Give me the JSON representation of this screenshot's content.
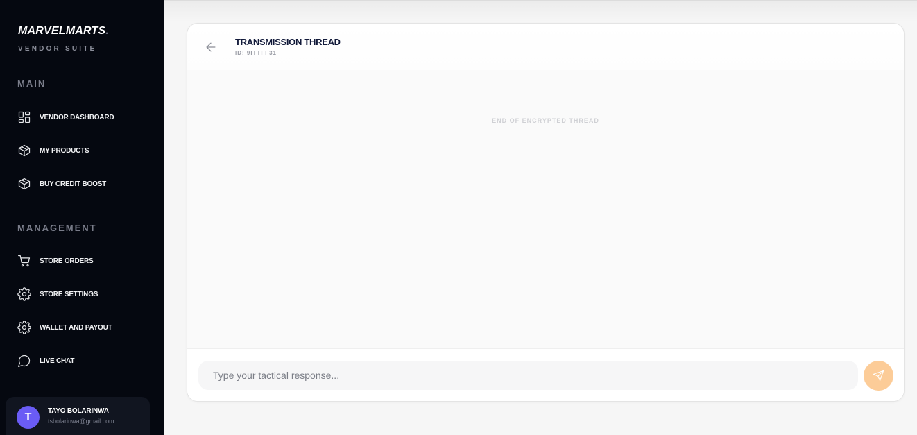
{
  "brand": {
    "name": "MARVELMARTS",
    "mark": ".",
    "subtitle": "VENDOR SUITE"
  },
  "sidebar": {
    "sections": [
      {
        "title": "MAIN"
      },
      {
        "title": "MANAGEMENT"
      }
    ],
    "items": [
      {
        "label": "VENDOR DASHBOARD",
        "icon": "grid-icon"
      },
      {
        "label": "MY PRODUCTS",
        "icon": "box-icon"
      },
      {
        "label": "BUY CREDIT BOOST",
        "icon": "box-icon"
      },
      {
        "label": "STORE ORDERS",
        "icon": "cart-icon"
      },
      {
        "label": "STORE SETTINGS",
        "icon": "gear-icon"
      },
      {
        "label": "WALLET AND PAYOUT",
        "icon": "gear-icon"
      },
      {
        "label": "LIVE CHAT",
        "icon": "chat-bubble-icon"
      }
    ]
  },
  "user": {
    "initial": "T",
    "name": "TAYO BOLARINWA",
    "email": "tsbolarinwa@gmail.com"
  },
  "thread": {
    "title": "TRANSMISSION THREAD",
    "id": "ID: 9ITTFF31",
    "end_note": "END OF ENCRYPTED THREAD"
  },
  "composer": {
    "placeholder": "Type your tactical response...",
    "value": ""
  },
  "colors": {
    "sidebar_bg": "#050810",
    "avatar": "#6a5cf5",
    "send_button": "#fccc98",
    "title": "#121a3a"
  }
}
